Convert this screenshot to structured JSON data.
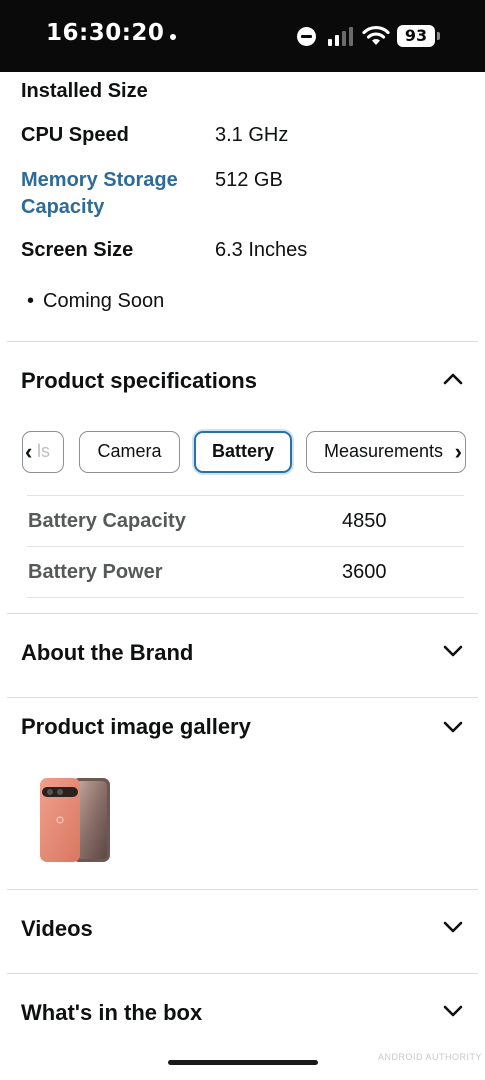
{
  "status_bar": {
    "time": "16:30:20",
    "battery_level": "93"
  },
  "specs": {
    "rows": [
      {
        "key": "Installed Size",
        "value": ""
      },
      {
        "key": "CPU Speed",
        "value": "3.1 GHz"
      },
      {
        "key": "Memory Storage Capacity",
        "key_line1": "Memory Storage",
        "key_line2": "Capacity",
        "value": "512 GB"
      },
      {
        "key": "Screen Size",
        "value": "6.3 Inches"
      }
    ],
    "bullet": "Coming Soon"
  },
  "product_specifications": {
    "title": "Product specifications",
    "chips": [
      {
        "label": "ls"
      },
      {
        "label": "Camera"
      },
      {
        "label": "Battery",
        "selected": true
      },
      {
        "label": "Measurements"
      }
    ],
    "table": [
      {
        "key": "Battery Capacity",
        "value": "4850"
      },
      {
        "key": "Battery Power",
        "value": "3600"
      }
    ]
  },
  "sections": {
    "about_brand": "About the Brand",
    "image_gallery": "Product image gallery",
    "videos": "Videos",
    "in_the_box": "What's in the box"
  },
  "watermark": "ANDROID AUTHORITY",
  "colors": {
    "link": "#2f6b96",
    "chip_selected_border": "#2a6fa6",
    "muted_key": "#565959"
  }
}
